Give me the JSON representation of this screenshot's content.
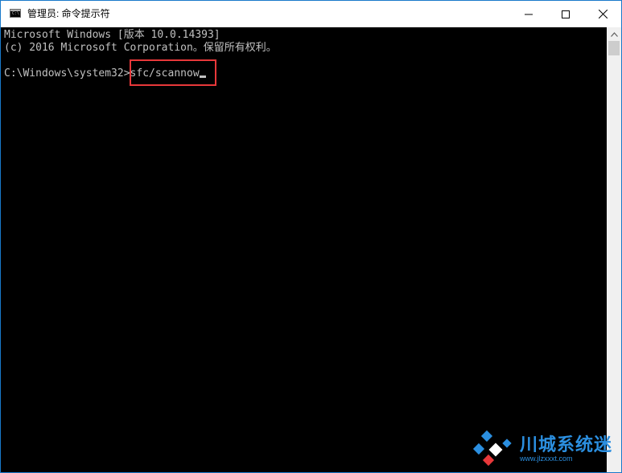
{
  "window": {
    "title": "管理员: 命令提示符",
    "icon_glyph": "C:\\",
    "controls": [
      "minimize-icon",
      "maximize-icon",
      "close-icon"
    ]
  },
  "console": {
    "lines": [
      "Microsoft Windows [版本 10.0.14393]",
      "(c) 2016 Microsoft Corporation。保留所有权利。"
    ],
    "prompt": "C:\\Windows\\system32>",
    "command": "sfc/scannow",
    "text_color": "#c0c0c0",
    "background": "#000000",
    "highlight_color": "#e8383a"
  },
  "watermark": {
    "title": "川城系统迷",
    "subtitle": "www.jlzxxxt.com"
  }
}
